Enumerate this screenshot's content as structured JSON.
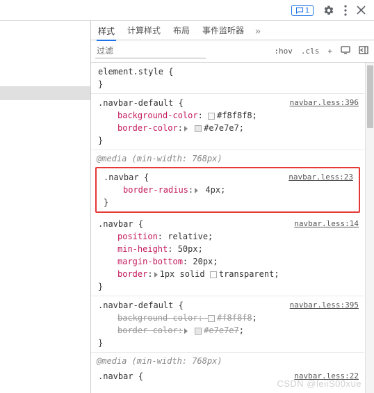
{
  "toolbar": {
    "messageCount": "1"
  },
  "tabs": {
    "items": [
      "样式",
      "计算样式",
      "布局",
      "事件监听器"
    ],
    "activeIndex": 0,
    "more": "»"
  },
  "filter": {
    "placeholder": "过滤",
    "hov": ":hov",
    "cls": ".cls",
    "plus": "+"
  },
  "rules": [
    {
      "selector": "element.style",
      "props": []
    },
    {
      "selector": ".navbar-default",
      "source": "navbar.less:396",
      "props": [
        {
          "name": "background-color",
          "value": "#f8f8f8",
          "swatch": "#f8f8f8"
        },
        {
          "name": "border-color",
          "value": "#e7e7e7",
          "swatch": "#e7e7e7",
          "expand": true
        }
      ]
    },
    {
      "media": "@media (min-width: 768px)",
      "selector": ".navbar",
      "source": "navbar.less:23",
      "highlight": true,
      "props": [
        {
          "name": "border-radius",
          "value": "4px",
          "expand": true
        }
      ]
    },
    {
      "selector": ".navbar",
      "source": "navbar.less:14",
      "props": [
        {
          "name": "position",
          "value": "relative"
        },
        {
          "name": "min-height",
          "value": "50px"
        },
        {
          "name": "margin-bottom",
          "value": "20px"
        },
        {
          "name": "border",
          "value": "1px solid",
          "valueExtra": "transparent",
          "swatchExtra": "transparent",
          "expand": true
        }
      ]
    },
    {
      "selector": ".navbar-default",
      "source": "navbar.less:395",
      "props": [
        {
          "name": "background-color",
          "value": "#f8f8f8",
          "swatch": "#f8f8f8",
          "struck": true
        },
        {
          "name": "border-color",
          "value": "#e7e7e7",
          "swatch": "#e7e7e7",
          "struck": true,
          "expand": true
        }
      ]
    },
    {
      "media": "@media (min-width: 768px)",
      "selector": ".navbar",
      "source": "navbar.less:22",
      "props": []
    }
  ],
  "watermark": "CSDN @leiiS00xue"
}
